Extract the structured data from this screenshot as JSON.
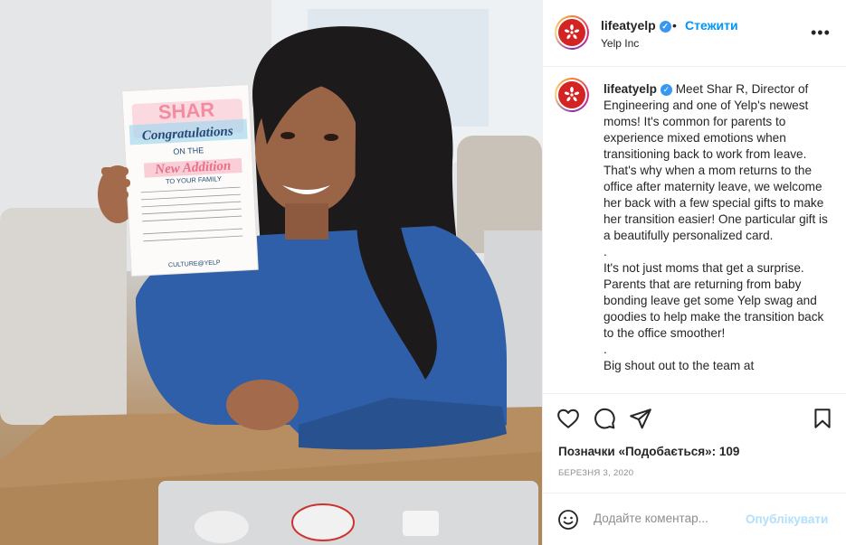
{
  "post": {
    "username": "lifeatyelp",
    "verified_icon": "verified-badge-icon",
    "separator": "•",
    "follow_label": "Стежити",
    "subtitle": "Yelp Inc",
    "caption_username": "lifeatyelp",
    "caption_text": "Meet Shar R, Director of Engineering and one of Yelp's newest moms! It's common for parents to experience mixed emotions when transitioning back to work from leave. That's why when a mom returns to the office after maternity leave, we welcome her back with a few special gifts to make her transition easier! One particular gift is a beautifully personalized card.\n.\nIt's not just moms that get a surprise. Parents that are returning from baby bonding leave get some Yelp swag and goodies to help make the transition back to the office smoother!\n.\nBig shout out to the team at",
    "likes": "Позначки «Подобається»: 109",
    "date": "БЕРЕЗНЯ 3, 2020",
    "comment_placeholder": "Додайте коментар...",
    "publish_label": "Опублікувати",
    "more_label": "•••"
  },
  "photo": {
    "card_title": "SHAR",
    "card_line1": "Congratulations",
    "card_line2": "ON THE",
    "card_line3": "New Addition",
    "card_line4": "TO YOUR FAMILY",
    "card_sign": "CULTURE@YELP"
  },
  "icons": [
    "heart-icon",
    "comment-icon",
    "share-icon",
    "bookmark-icon",
    "emoji-icon",
    "more-icon",
    "yelp-logo-icon"
  ],
  "colors": {
    "accent": "#0095f6",
    "publish_disabled": "#b2dffc",
    "yelp_red": "#d32323"
  }
}
